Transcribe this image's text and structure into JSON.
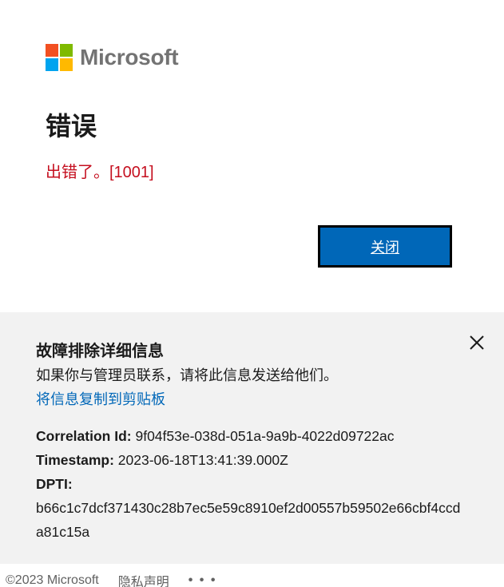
{
  "logo": {
    "text": "Microsoft",
    "colors": [
      "#f25022",
      "#7fba00",
      "#00a4ef",
      "#ffb900"
    ]
  },
  "error": {
    "title": "错误",
    "message": "出错了。[1001]",
    "message_color": "#c50f1f"
  },
  "buttons": {
    "close_label": "关闭",
    "accent": "#0067b8"
  },
  "troubleshooting": {
    "title": "故障排除详细信息",
    "description": "如果你与管理员联系，请将此信息发送给他们。",
    "copy_link": "将信息复制到剪贴板",
    "close_icon": "close-icon",
    "correlation_label": "Correlation Id:",
    "correlation_value": "9f04f53e-038d-051a-9a9b-4022d09722ac",
    "timestamp_label": "Timestamp:",
    "timestamp_value": "2023-06-18T13:41:39.000Z",
    "dpti_label": "DPTI:",
    "dpti_value": "b66c1c7dcf371430c28b7ec5e59c8910ef2d00557b59502e66cbf4ccda81c15a"
  },
  "footer": {
    "copyright": "©2023 Microsoft",
    "privacy": "隐私声明",
    "more": "• • •"
  }
}
